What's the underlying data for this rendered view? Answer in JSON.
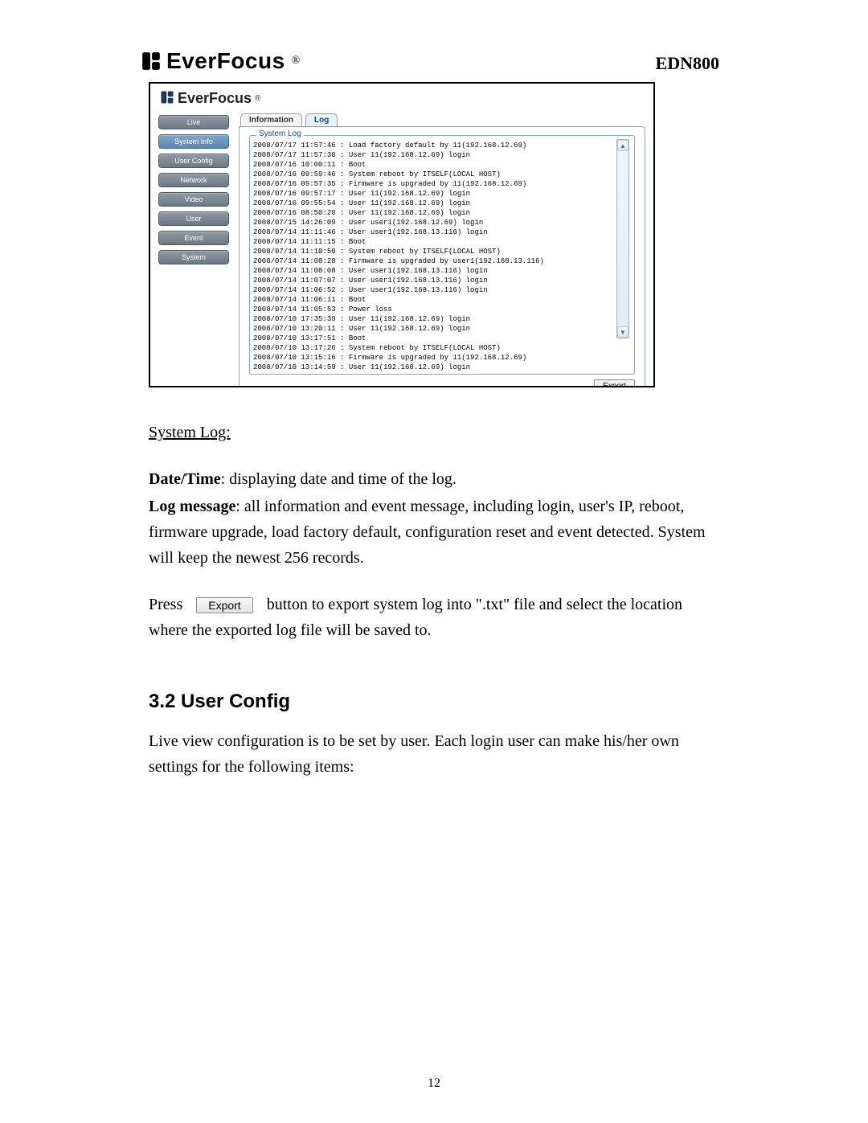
{
  "header": {
    "brand": "EverFocus",
    "model": "EDN800"
  },
  "app": {
    "brand": "EverFocus",
    "sidebar": {
      "items": [
        {
          "label": "Live"
        },
        {
          "label": "System Info"
        },
        {
          "label": "User Config"
        },
        {
          "label": "Network"
        },
        {
          "label": "Video"
        },
        {
          "label": "User"
        },
        {
          "label": "Event"
        },
        {
          "label": "System"
        }
      ]
    },
    "tabs": {
      "information": "Information",
      "log": "Log"
    },
    "fieldset_legend": "System Log",
    "log_lines": [
      "2008/07/17 11:57:46 : Load factory default by 11(192.168.12.69)",
      "2008/07/17 11:57:30 : User 11(192.168.12.69) login",
      "2008/07/16 10:00:11 : Boot",
      "2008/07/16 09:59:46 : System reboot by ITSELF(LOCAL HOST)",
      "2008/07/16 09:57:35 : Firmware is upgraded by 11(192.168.12.69)",
      "2008/07/16 09:57:17 : User 11(192.168.12.69) login",
      "2008/07/16 09:55:54 : User 11(192.168.12.69) login",
      "2008/07/16 08:50:20 : User 11(192.168.12.69) login",
      "2008/07/15 14:26:09 : User user1(192.168.12.69) login",
      "2008/07/14 11:11:46 : User user1(192.168.13.116) login",
      "2008/07/14 11:11:15 : Boot",
      "2008/07/14 11:10:50 : System reboot by ITSELF(LOCAL HOST)",
      "2008/07/14 11:08:28 : Firmware is upgraded by user1(192.168.13.116)",
      "2008/07/14 11:08:08 : User user1(192.168.13.116) login",
      "2008/07/14 11:07:07 : User user1(192.168.13.116) login",
      "2008/07/14 11:06:52 : User user1(192.168.13.116) login",
      "2008/07/14 11:06:11 : Boot",
      "2008/07/14 11:05:53 : Power loss",
      "2008/07/10 17:35:39 : User 11(192.168.12.69) login",
      "2008/07/10 13:20:11 : User 11(192.168.12.69) login",
      "2008/07/10 13:17:51 : Boot",
      "2008/07/10 13:17:26 : System reboot by ITSELF(LOCAL HOST)",
      "2008/07/10 13:15:16 : Firmware is upgraded by 11(192.168.12.69)",
      "2008/07/10 13:14:59 : User 11(192.168.12.69) login"
    ],
    "export_label": "Export"
  },
  "body": {
    "h3": "System Log:",
    "datetime_label": "Date/Time",
    "datetime_text": ": displaying date and time of the log.",
    "logmsg_label": "Log message",
    "logmsg_text": ": all information and event message, including login, user's IP, reboot, firmware upgrade, load factory default, configuration reset and event detected. System will keep the newest 256 records.",
    "press_before": "Press",
    "export_inline": "Export",
    "press_after": "button to export system log into \".txt\" file and select the location where the exported log file will be saved to.",
    "h2": "3.2 User Config",
    "userconfig_text": "Live view configuration is to be set by user. Each login user can make his/her own settings for the following items:"
  },
  "page_number": "12"
}
